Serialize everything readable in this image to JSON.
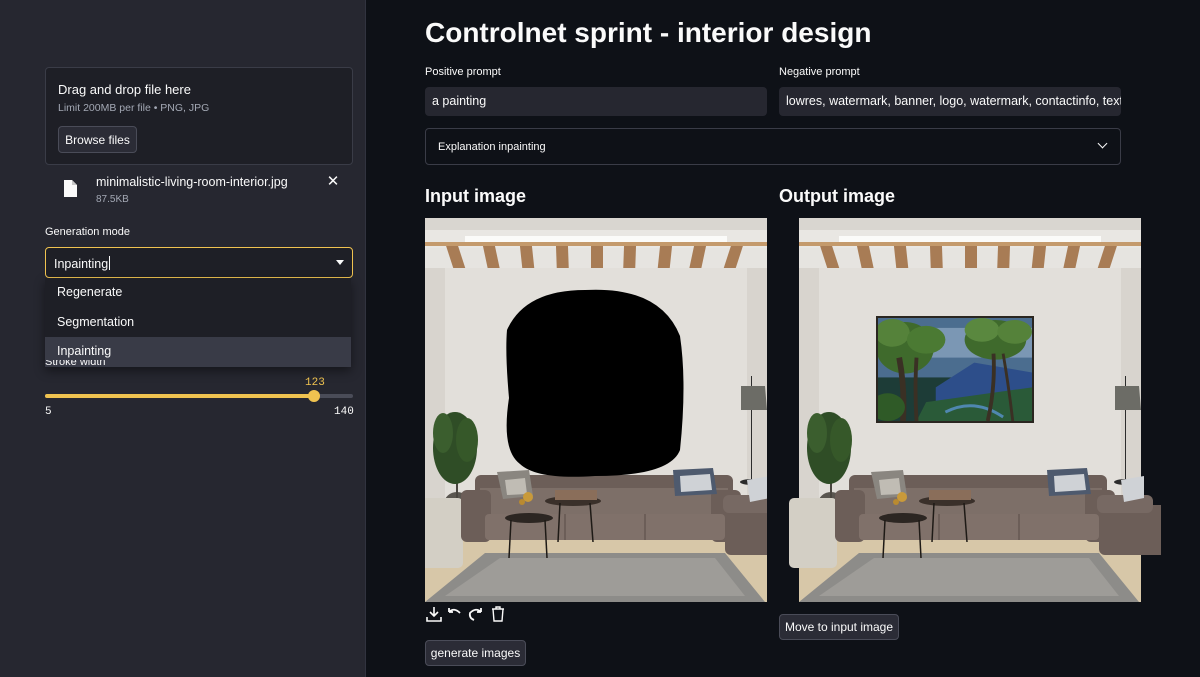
{
  "sidebar": {
    "upload": {
      "title": "Drag and drop file here",
      "limit": "Limit 200MB per file • PNG, JPG",
      "browse_label": "Browse files"
    },
    "file": {
      "name": "minimalistic-living-room-interior.jpg",
      "size": "87.5KB"
    },
    "generation_mode": {
      "label": "Generation mode",
      "value": "Inpainting",
      "options": [
        "Regenerate",
        "Segmentation",
        "Inpainting"
      ],
      "selected_index": 2
    },
    "stroke": {
      "label": "Stroke width",
      "value": "123",
      "min": "5",
      "max": "140"
    }
  },
  "main": {
    "title": "Controlnet sprint - interior design",
    "positive": {
      "label": "Positive prompt",
      "value": "a painting"
    },
    "negative": {
      "label": "Negative prompt",
      "value": "lowres, watermark, banner, logo, watermark, contactinfo, text, deformed"
    },
    "expander_label": "Explanation inpainting",
    "input_title": "Input image",
    "output_title": "Output image",
    "generate_label": "generate images",
    "move_label": "Move to input image"
  },
  "colors": {
    "background": "#0e1117",
    "sidebar": "#262730",
    "accent": "#f0c350",
    "text": "#fafafa"
  },
  "icons": [
    "file-icon",
    "close-icon",
    "chevron-down-icon",
    "download-icon",
    "undo-icon",
    "redo-icon",
    "trash-icon"
  ]
}
